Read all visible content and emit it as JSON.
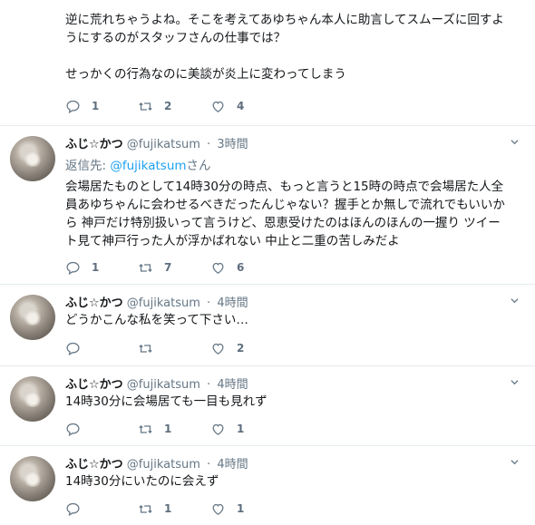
{
  "tweets": [
    {
      "name": "",
      "handle": "",
      "time": "",
      "reply_prefix": "",
      "reply_user": "",
      "reply_suffix": "",
      "lines": [
        "逆に荒れちゃうよね。そこを考えてあゆちゃん本人に助言してスムーズに回すよ",
        "うにするのがスタッフさんの仕事では？",
        "",
        "せっかくの行為なのに美談が炎上に変わってしまう"
      ],
      "replies": "1",
      "retweets": "2",
      "likes": "4"
    },
    {
      "name": "ふじ☆かつ",
      "handle": "@fujikatsum",
      "time": "3時間",
      "reply_prefix": "返信先: ",
      "reply_user": "@fujikatsum",
      "reply_suffix": "さん",
      "lines": [
        "会場居たものとして14時30分の時点、もっと言うと15時の時点で会場居た人全",
        "員あゆちゃんに会わせるべきだったんじゃない？握手とか無しで流れでもいいか",
        "ら 神戸だけ特別扱いって言うけど、恩恵受けたのはほんのほんの一握り ツイー",
        "ト見て神戸行った人が浮かばれない 中止と二重の苦しみだよ"
      ],
      "replies": "1",
      "retweets": "7",
      "likes": "6"
    },
    {
      "name": "ふじ☆かつ",
      "handle": "@fujikatsum",
      "time": "4時間",
      "lines": [
        "どうかこんな私を笑って下さい…"
      ],
      "replies": "",
      "retweets": "",
      "likes": "2"
    },
    {
      "name": "ふじ☆かつ",
      "handle": "@fujikatsum",
      "time": "4時間",
      "lines": [
        "14時30分に会場居ても一目も見れず"
      ],
      "replies": "",
      "retweets": "1",
      "likes": "1"
    },
    {
      "name": "ふじ☆かつ",
      "handle": "@fujikatsum",
      "time": "4時間",
      "lines": [
        "14時30分にいたのに会えず"
      ],
      "replies": "",
      "retweets": "1",
      "likes": "1"
    }
  ],
  "icons": [
    "reply-icon",
    "retweet-icon",
    "like-icon",
    "caret-down-icon"
  ],
  "colors": {
    "link": "#1da1f2",
    "meta": "#657786",
    "divider": "#e6ecf0"
  }
}
